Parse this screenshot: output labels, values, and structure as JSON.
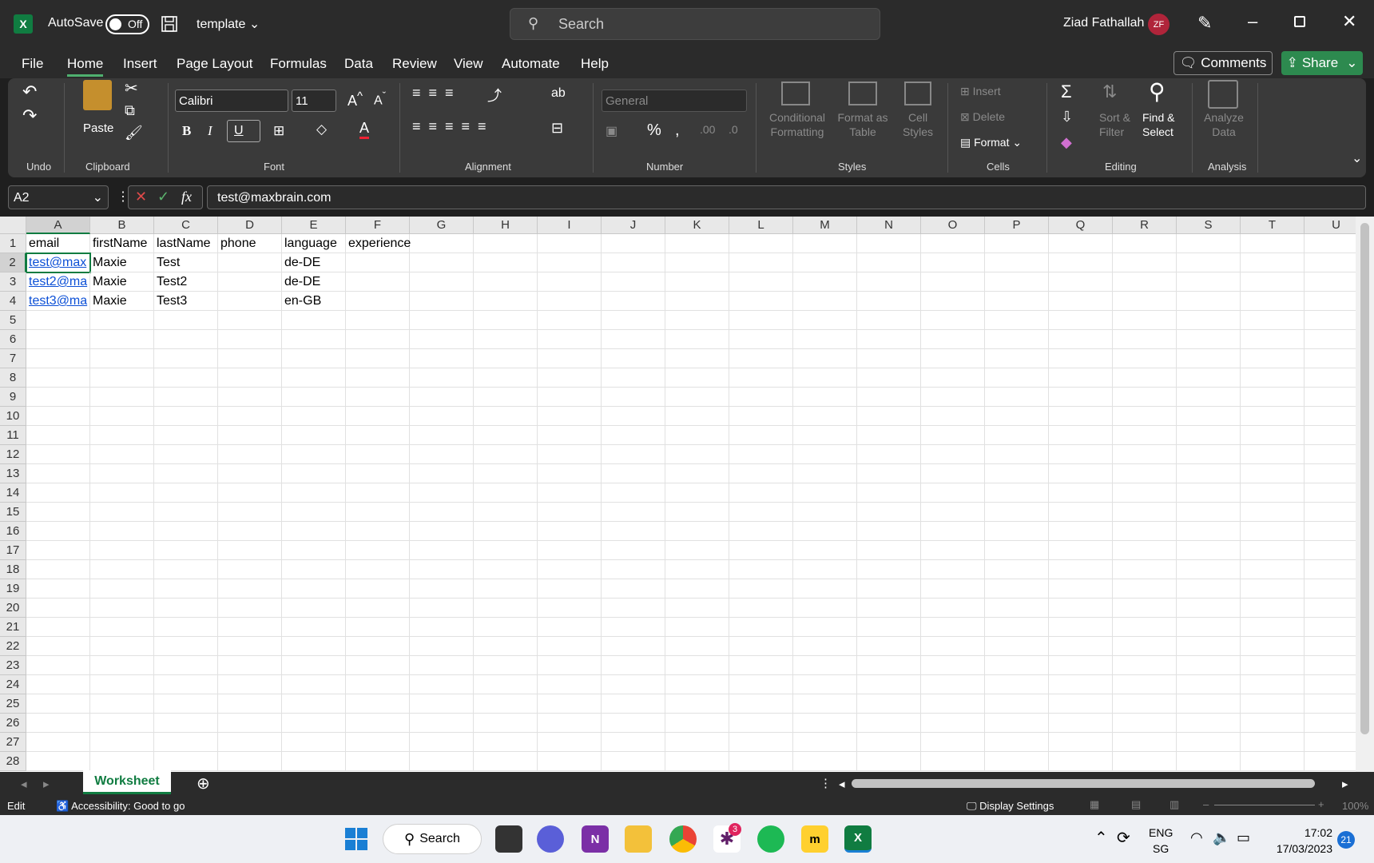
{
  "titlebar": {
    "app_icon": "excel-logo",
    "autosave_label": "AutoSave",
    "autosave_state": "Off",
    "doc_name": "template",
    "search_placeholder": "Search",
    "user_name": "Ziad Fathallah",
    "user_initials": "ZF"
  },
  "menu": {
    "tabs": [
      "File",
      "Home",
      "Insert",
      "Page Layout",
      "Formulas",
      "Data",
      "Review",
      "View",
      "Automate",
      "Help"
    ],
    "active": "Home",
    "comments": "Comments",
    "share": "Share"
  },
  "ribbon": {
    "groups": {
      "undo": "Undo",
      "clipboard": "Clipboard",
      "font": "Font",
      "alignment": "Alignment",
      "number": "Number",
      "styles": "Styles",
      "cells": "Cells",
      "editing": "Editing",
      "analysis": "Analysis"
    },
    "paste": "Paste",
    "font_name": "Calibri",
    "font_size": "11",
    "number_format": "General",
    "conditional": [
      "Conditional",
      "Formatting"
    ],
    "format_table": [
      "Format as",
      "Table"
    ],
    "cell_styles": [
      "Cell",
      "Styles"
    ],
    "insert": "Insert",
    "delete": "Delete",
    "format": "Format",
    "sort": [
      "Sort &",
      "Filter"
    ],
    "find": [
      "Find &",
      "Select"
    ],
    "analyze": [
      "Analyze",
      "Data"
    ]
  },
  "formula_bar": {
    "name_box": "A2",
    "formula": "test@maxbrain.com"
  },
  "sheet": {
    "columns": [
      "A",
      "B",
      "C",
      "D",
      "E",
      "F",
      "G",
      "H",
      "I",
      "J",
      "K",
      "L",
      "M",
      "N",
      "O",
      "P",
      "Q",
      "R",
      "S",
      "T",
      "U"
    ],
    "rows": [
      "1",
      "2",
      "3",
      "4",
      "5",
      "6",
      "7",
      "8",
      "9",
      "10",
      "11",
      "12",
      "13",
      "14",
      "15",
      "16",
      "17",
      "18",
      "19",
      "20",
      "21",
      "22",
      "23",
      "24",
      "25",
      "26",
      "27",
      "28"
    ],
    "headers": [
      "email",
      "firstName",
      "lastName",
      "phone",
      "language",
      "experience"
    ],
    "data": [
      [
        "test@max",
        "Maxie",
        "Test",
        "",
        "de-DE",
        ""
      ],
      [
        "test2@ma",
        "Maxie",
        "Test2",
        "",
        "de-DE",
        ""
      ],
      [
        "test3@ma",
        "Maxie",
        "Test3",
        "",
        "en-GB",
        ""
      ]
    ],
    "tab_name": "Worksheet"
  },
  "status": {
    "mode": "Edit",
    "accessibility": "Accessibility: Good to go",
    "display_settings": "Display Settings",
    "zoom": "100%"
  },
  "taskbar": {
    "search": "Search",
    "slack_badge": "3",
    "lang": "ENG",
    "region": "SG",
    "time": "17:02",
    "date": "17/03/2023",
    "notif": "21"
  }
}
